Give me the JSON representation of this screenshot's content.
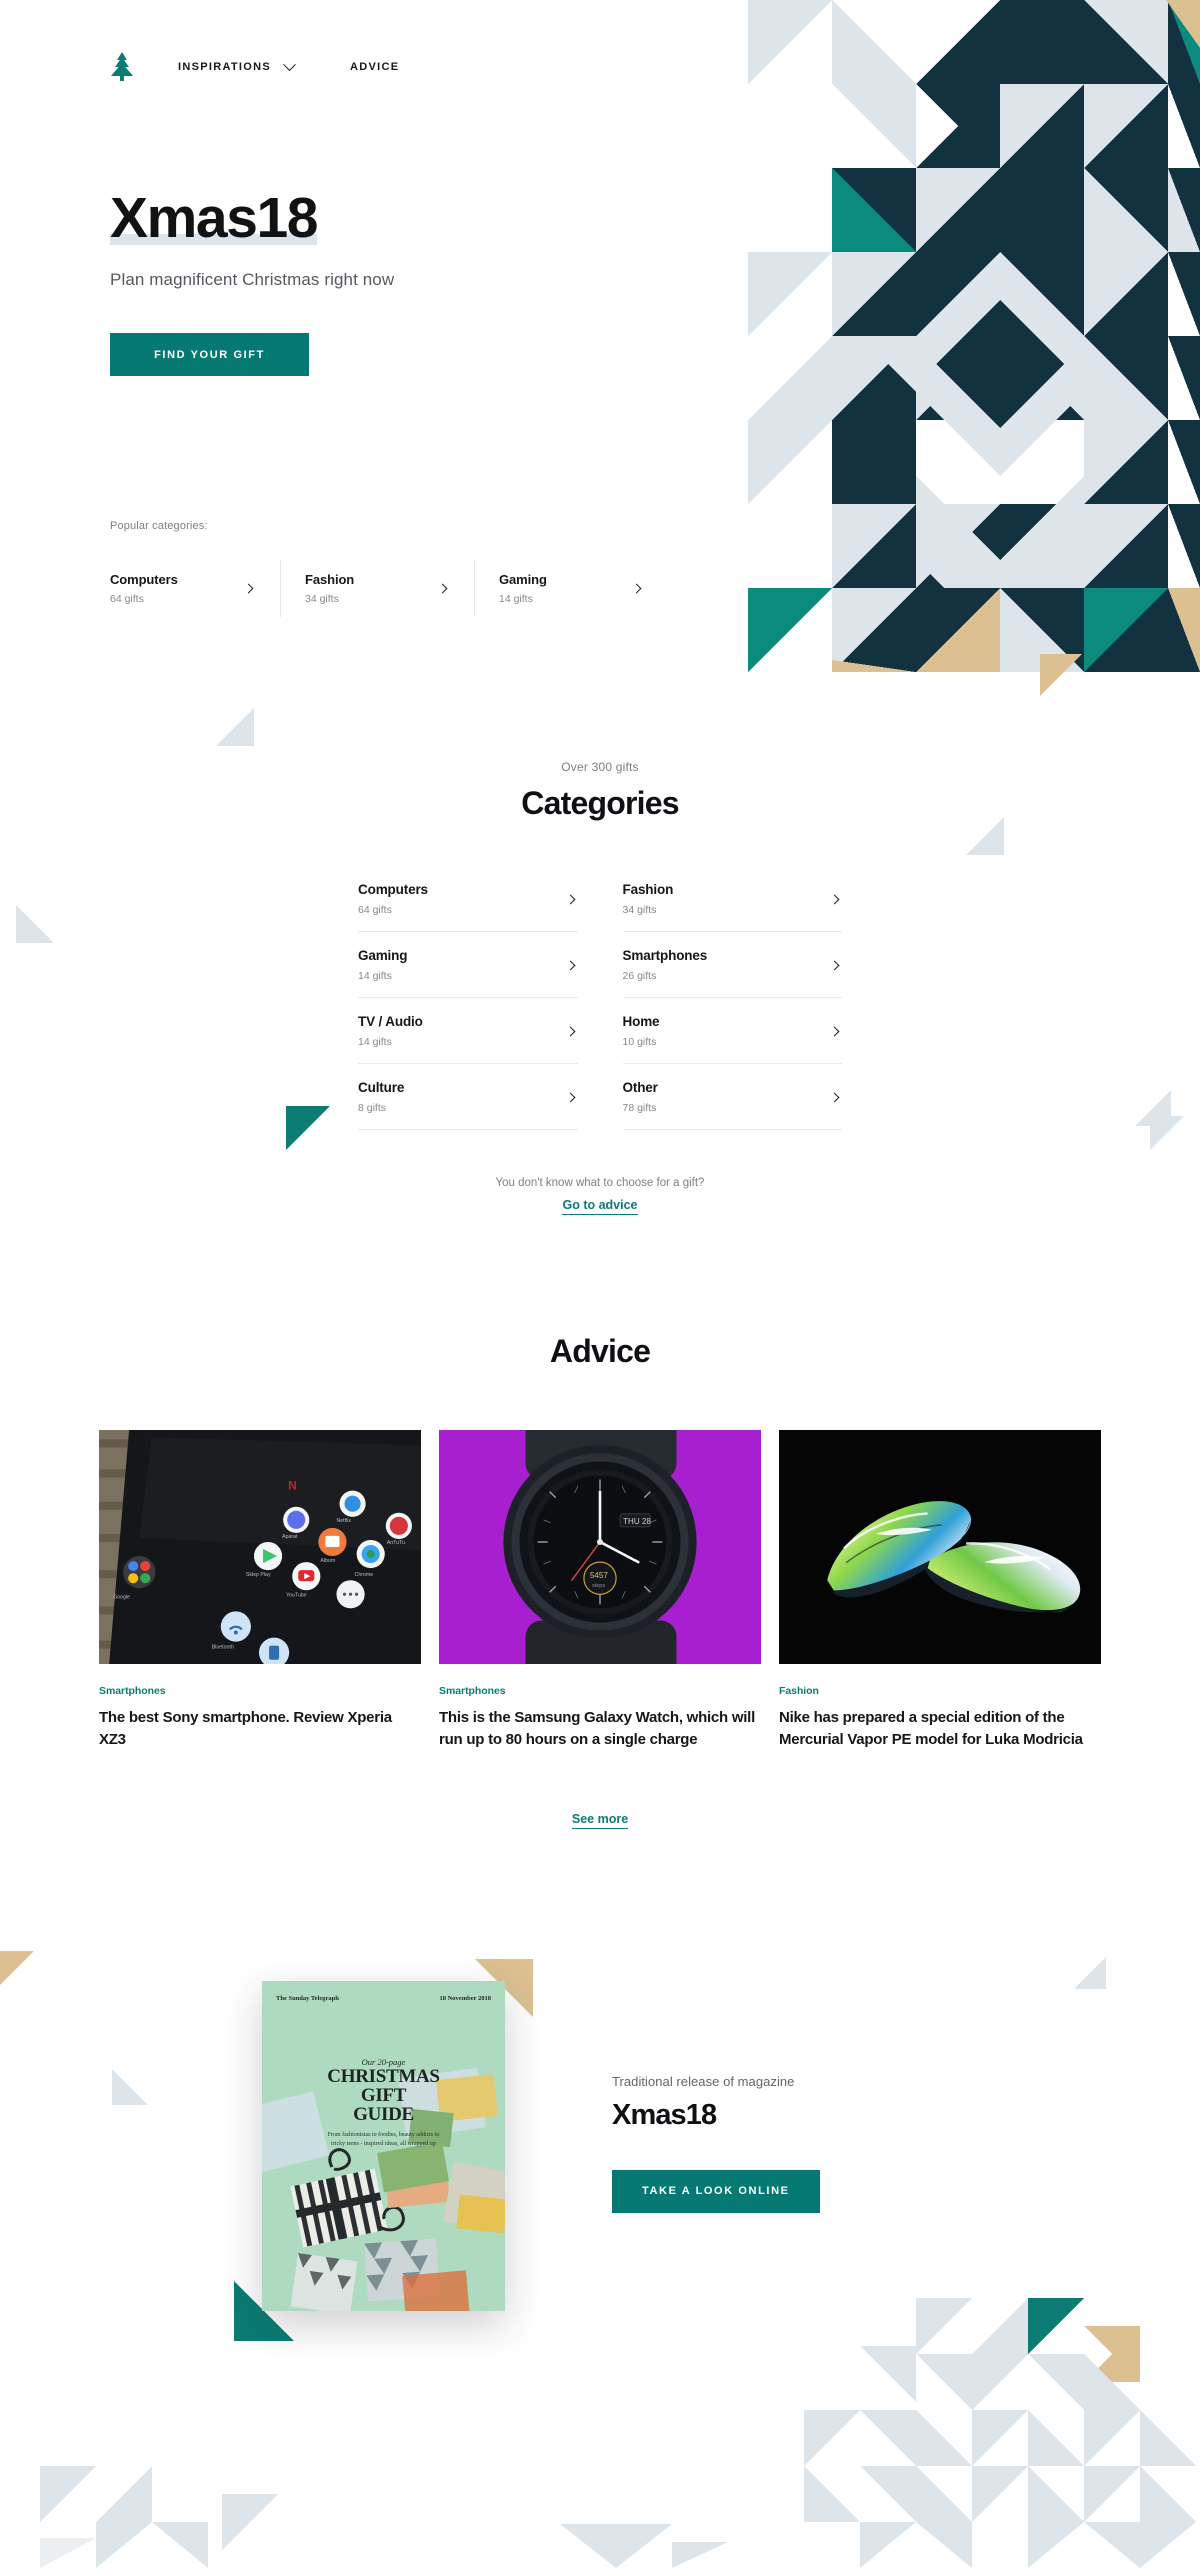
{
  "colors": {
    "teal": "#067a72",
    "dark": "#123240",
    "pale_blue": "#dde5ea",
    "tan": "#dcc091",
    "ink": "#101214"
  },
  "nav": {
    "logo_icon": "christmas-tree-icon",
    "items": [
      {
        "label": "INSPIRATIONS",
        "has_dropdown": true
      },
      {
        "label": "ADVICE",
        "has_dropdown": false
      }
    ]
  },
  "hero": {
    "title": "Xmas18",
    "subtitle": "Plan magnificent Christmas right now",
    "cta_label": "FIND YOUR GIFT",
    "popular_label": "Popular categories:",
    "popular": [
      {
        "name": "Computers",
        "count": "64 gifts"
      },
      {
        "name": "Fashion",
        "count": "34 gifts"
      },
      {
        "name": "Gaming",
        "count": "14 gifts"
      }
    ]
  },
  "categories": {
    "eyebrow": "Over 300 gifts",
    "title": "Categories",
    "items": [
      {
        "name": "Computers",
        "count": "64 gifts"
      },
      {
        "name": "Fashion",
        "count": "34 gifts"
      },
      {
        "name": "Gaming",
        "count": "14 gifts"
      },
      {
        "name": "Smartphones",
        "count": "26 gifts"
      },
      {
        "name": "TV / Audio",
        "count": "14 gifts"
      },
      {
        "name": "Home",
        "count": "10 gifts"
      },
      {
        "name": "Culture",
        "count": "8 gifts"
      },
      {
        "name": "Other",
        "count": "78 gifts"
      }
    ],
    "question": "You don't know what to choose for a gift?",
    "link_label": "Go to advice"
  },
  "advice": {
    "title": "Advice",
    "see_more_label": "See more",
    "articles": [
      {
        "tag": "Smartphones",
        "title": "The best Sony smartphone. Review Xperia XZ3",
        "image": "smartphone-home-screen-photo"
      },
      {
        "tag": "Smartphones",
        "title": "This is the Samsung Galaxy Watch, which will run up to 80 hours on a single charge",
        "image": "samsung-galaxy-watch-photo"
      },
      {
        "tag": "Fashion",
        "title": "Nike has prepared a special edition of the Mercurial Vapor PE model for Luka Modricia",
        "image": "nike-mercurial-boots-photo"
      }
    ]
  },
  "magazine": {
    "kicker": "Traditional release of magazine",
    "title": "Xmas18",
    "cta_label": "TAKE A LOOK ONLINE",
    "cover": {
      "masthead": "The Sunday Telegraph",
      "date": "18 November 2018",
      "our_line": "Our 20-page",
      "headline_1": "CHRISTMAS",
      "headline_2": "GIFT",
      "headline_3": "GUIDE",
      "description": "From fashionistas to foodies, beauty addicts to tricky teens - inspired ideas, all wrapped up"
    }
  }
}
